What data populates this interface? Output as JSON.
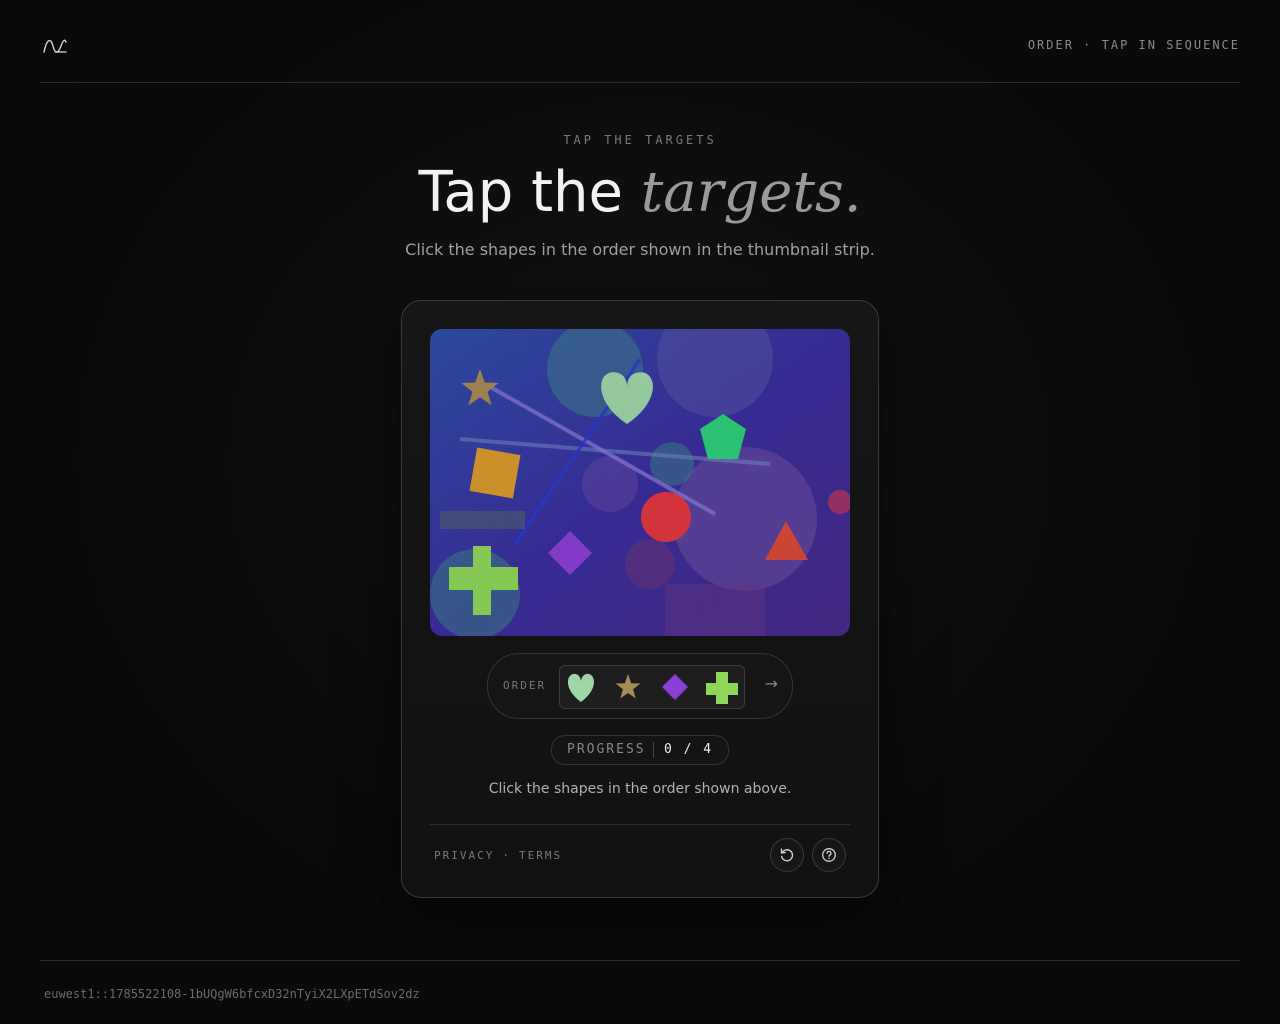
{
  "header": {
    "top_right": "ORDER · TAP IN SEQUENCE"
  },
  "hero": {
    "eyebrow": "TAP THE TARGETS",
    "title_plain": "Tap the ",
    "title_accent": "targets.",
    "subtitle": "Click the shapes in the order shown in the thumbnail strip."
  },
  "challenge": {
    "order_label": "ORDER",
    "order_sequence": [
      "heart",
      "star",
      "diamond",
      "cross"
    ],
    "progress_label": "PROGRESS",
    "progress_value": "0 / 4",
    "progress_current": 0,
    "progress_total": 4,
    "instruction": "Click the shapes in the order shown above.",
    "shapes": [
      "star",
      "heart",
      "pentagon",
      "square",
      "circle",
      "diamond",
      "triangle",
      "cross"
    ],
    "colors": {
      "background": "#3a2f9e",
      "star": "#a88a55",
      "heart": "#9ed6a8",
      "pentagon": "#2fcf7a",
      "square": "#d9992f",
      "circle": "#e0383f",
      "diamond": "#8a3fd6",
      "triangle": "#d94a3a",
      "cross": "#8ed65a"
    }
  },
  "footer": {
    "privacy": "PRIVACY",
    "separator": "·",
    "terms": "TERMS",
    "session_id": "euwest1::1785522108-1bUQgW6bfcxD32nTyiX2LXpETdSov2dz"
  },
  "icons": {
    "logo": "wave-logo-icon",
    "reload": "reload-icon",
    "help": "help-icon",
    "next": "arrow-right-icon"
  }
}
